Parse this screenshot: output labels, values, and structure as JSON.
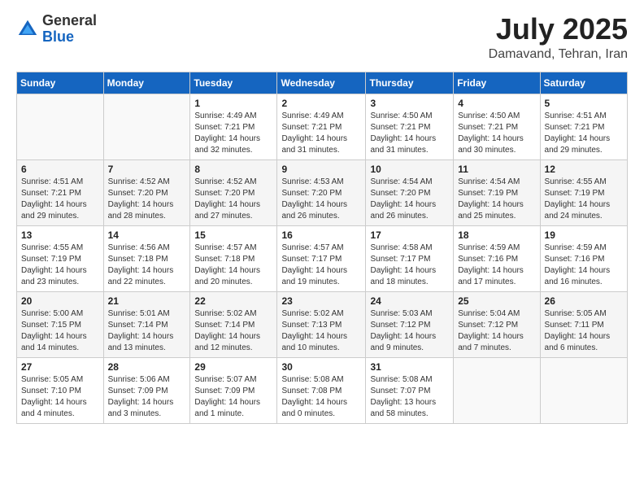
{
  "logo": {
    "general": "General",
    "blue": "Blue"
  },
  "header": {
    "month": "July 2025",
    "location": "Damavand, Tehran, Iran"
  },
  "weekdays": [
    "Sunday",
    "Monday",
    "Tuesday",
    "Wednesday",
    "Thursday",
    "Friday",
    "Saturday"
  ],
  "weeks": [
    [
      {
        "day": "",
        "sunrise": "",
        "sunset": "",
        "daylight": ""
      },
      {
        "day": "",
        "sunrise": "",
        "sunset": "",
        "daylight": ""
      },
      {
        "day": "1",
        "sunrise": "Sunrise: 4:49 AM",
        "sunset": "Sunset: 7:21 PM",
        "daylight": "Daylight: 14 hours and 32 minutes."
      },
      {
        "day": "2",
        "sunrise": "Sunrise: 4:49 AM",
        "sunset": "Sunset: 7:21 PM",
        "daylight": "Daylight: 14 hours and 31 minutes."
      },
      {
        "day": "3",
        "sunrise": "Sunrise: 4:50 AM",
        "sunset": "Sunset: 7:21 PM",
        "daylight": "Daylight: 14 hours and 31 minutes."
      },
      {
        "day": "4",
        "sunrise": "Sunrise: 4:50 AM",
        "sunset": "Sunset: 7:21 PM",
        "daylight": "Daylight: 14 hours and 30 minutes."
      },
      {
        "day": "5",
        "sunrise": "Sunrise: 4:51 AM",
        "sunset": "Sunset: 7:21 PM",
        "daylight": "Daylight: 14 hours and 29 minutes."
      }
    ],
    [
      {
        "day": "6",
        "sunrise": "Sunrise: 4:51 AM",
        "sunset": "Sunset: 7:21 PM",
        "daylight": "Daylight: 14 hours and 29 minutes."
      },
      {
        "day": "7",
        "sunrise": "Sunrise: 4:52 AM",
        "sunset": "Sunset: 7:20 PM",
        "daylight": "Daylight: 14 hours and 28 minutes."
      },
      {
        "day": "8",
        "sunrise": "Sunrise: 4:52 AM",
        "sunset": "Sunset: 7:20 PM",
        "daylight": "Daylight: 14 hours and 27 minutes."
      },
      {
        "day": "9",
        "sunrise": "Sunrise: 4:53 AM",
        "sunset": "Sunset: 7:20 PM",
        "daylight": "Daylight: 14 hours and 26 minutes."
      },
      {
        "day": "10",
        "sunrise": "Sunrise: 4:54 AM",
        "sunset": "Sunset: 7:20 PM",
        "daylight": "Daylight: 14 hours and 26 minutes."
      },
      {
        "day": "11",
        "sunrise": "Sunrise: 4:54 AM",
        "sunset": "Sunset: 7:19 PM",
        "daylight": "Daylight: 14 hours and 25 minutes."
      },
      {
        "day": "12",
        "sunrise": "Sunrise: 4:55 AM",
        "sunset": "Sunset: 7:19 PM",
        "daylight": "Daylight: 14 hours and 24 minutes."
      }
    ],
    [
      {
        "day": "13",
        "sunrise": "Sunrise: 4:55 AM",
        "sunset": "Sunset: 7:19 PM",
        "daylight": "Daylight: 14 hours and 23 minutes."
      },
      {
        "day": "14",
        "sunrise": "Sunrise: 4:56 AM",
        "sunset": "Sunset: 7:18 PM",
        "daylight": "Daylight: 14 hours and 22 minutes."
      },
      {
        "day": "15",
        "sunrise": "Sunrise: 4:57 AM",
        "sunset": "Sunset: 7:18 PM",
        "daylight": "Daylight: 14 hours and 20 minutes."
      },
      {
        "day": "16",
        "sunrise": "Sunrise: 4:57 AM",
        "sunset": "Sunset: 7:17 PM",
        "daylight": "Daylight: 14 hours and 19 minutes."
      },
      {
        "day": "17",
        "sunrise": "Sunrise: 4:58 AM",
        "sunset": "Sunset: 7:17 PM",
        "daylight": "Daylight: 14 hours and 18 minutes."
      },
      {
        "day": "18",
        "sunrise": "Sunrise: 4:59 AM",
        "sunset": "Sunset: 7:16 PM",
        "daylight": "Daylight: 14 hours and 17 minutes."
      },
      {
        "day": "19",
        "sunrise": "Sunrise: 4:59 AM",
        "sunset": "Sunset: 7:16 PM",
        "daylight": "Daylight: 14 hours and 16 minutes."
      }
    ],
    [
      {
        "day": "20",
        "sunrise": "Sunrise: 5:00 AM",
        "sunset": "Sunset: 7:15 PM",
        "daylight": "Daylight: 14 hours and 14 minutes."
      },
      {
        "day": "21",
        "sunrise": "Sunrise: 5:01 AM",
        "sunset": "Sunset: 7:14 PM",
        "daylight": "Daylight: 14 hours and 13 minutes."
      },
      {
        "day": "22",
        "sunrise": "Sunrise: 5:02 AM",
        "sunset": "Sunset: 7:14 PM",
        "daylight": "Daylight: 14 hours and 12 minutes."
      },
      {
        "day": "23",
        "sunrise": "Sunrise: 5:02 AM",
        "sunset": "Sunset: 7:13 PM",
        "daylight": "Daylight: 14 hours and 10 minutes."
      },
      {
        "day": "24",
        "sunrise": "Sunrise: 5:03 AM",
        "sunset": "Sunset: 7:12 PM",
        "daylight": "Daylight: 14 hours and 9 minutes."
      },
      {
        "day": "25",
        "sunrise": "Sunrise: 5:04 AM",
        "sunset": "Sunset: 7:12 PM",
        "daylight": "Daylight: 14 hours and 7 minutes."
      },
      {
        "day": "26",
        "sunrise": "Sunrise: 5:05 AM",
        "sunset": "Sunset: 7:11 PM",
        "daylight": "Daylight: 14 hours and 6 minutes."
      }
    ],
    [
      {
        "day": "27",
        "sunrise": "Sunrise: 5:05 AM",
        "sunset": "Sunset: 7:10 PM",
        "daylight": "Daylight: 14 hours and 4 minutes."
      },
      {
        "day": "28",
        "sunrise": "Sunrise: 5:06 AM",
        "sunset": "Sunset: 7:09 PM",
        "daylight": "Daylight: 14 hours and 3 minutes."
      },
      {
        "day": "29",
        "sunrise": "Sunrise: 5:07 AM",
        "sunset": "Sunset: 7:09 PM",
        "daylight": "Daylight: 14 hours and 1 minute."
      },
      {
        "day": "30",
        "sunrise": "Sunrise: 5:08 AM",
        "sunset": "Sunset: 7:08 PM",
        "daylight": "Daylight: 14 hours and 0 minutes."
      },
      {
        "day": "31",
        "sunrise": "Sunrise: 5:08 AM",
        "sunset": "Sunset: 7:07 PM",
        "daylight": "Daylight: 13 hours and 58 minutes."
      },
      {
        "day": "",
        "sunrise": "",
        "sunset": "",
        "daylight": ""
      },
      {
        "day": "",
        "sunrise": "",
        "sunset": "",
        "daylight": ""
      }
    ]
  ]
}
